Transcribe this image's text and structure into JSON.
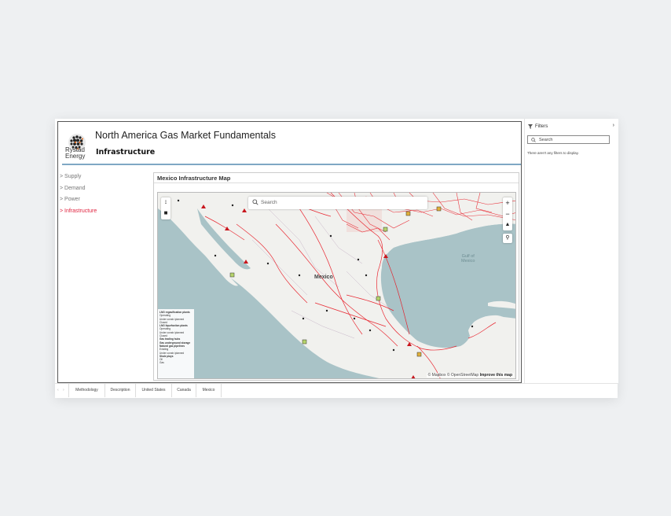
{
  "header": {
    "logo_line1": "Rystad",
    "logo_line2": "Energy",
    "title": "North America Gas Market Fundamentals",
    "subtitle": "Infrastructure"
  },
  "nav": {
    "items": [
      {
        "label": "> Supply",
        "active": false
      },
      {
        "label": "> Demand",
        "active": false
      },
      {
        "label": "> Power",
        "active": false
      },
      {
        "label": "> Infrastructure",
        "active": true
      }
    ]
  },
  "map": {
    "title": "Mexico Infrastructure Map",
    "search_placeholder": "Search",
    "country_label": "Mexico",
    "water_label_line1": "Gulf of",
    "water_label_line2": "Mexico",
    "attribution_prefix": "© Mapbox © OpenStreetMap",
    "attribution_link": "Improve this map",
    "legend": {
      "lng_regas_title": "LNG regasification plants",
      "lng_regas_items": [
        "Operating",
        "Under constr./planned",
        "Closed"
      ],
      "lng_liq_title": "LNG liquefaction plants",
      "lng_liq_items": [
        "Operating",
        "Under constr./planned",
        "Closed"
      ],
      "hubs_title": "Gas trading hubs",
      "storage_title": "Gas underground storage",
      "pipelines_title": "Natural gas pipelines",
      "pipeline_items": [
        "Existing",
        "Under constr./planned"
      ],
      "shale_title": "Shale plays",
      "shale_items": [
        "Oil",
        "Gas"
      ]
    },
    "colors": {
      "water": "#a9c3c7",
      "land": "#f1f1ee",
      "pipeline": "#e8141f"
    }
  },
  "filters": {
    "title": "Filters",
    "search_placeholder": "Search",
    "empty_message": "There aren't any filters to display."
  },
  "tabs": {
    "items": [
      "Methodology",
      "Description",
      "United States",
      "Canada",
      "Mexico"
    ]
  }
}
